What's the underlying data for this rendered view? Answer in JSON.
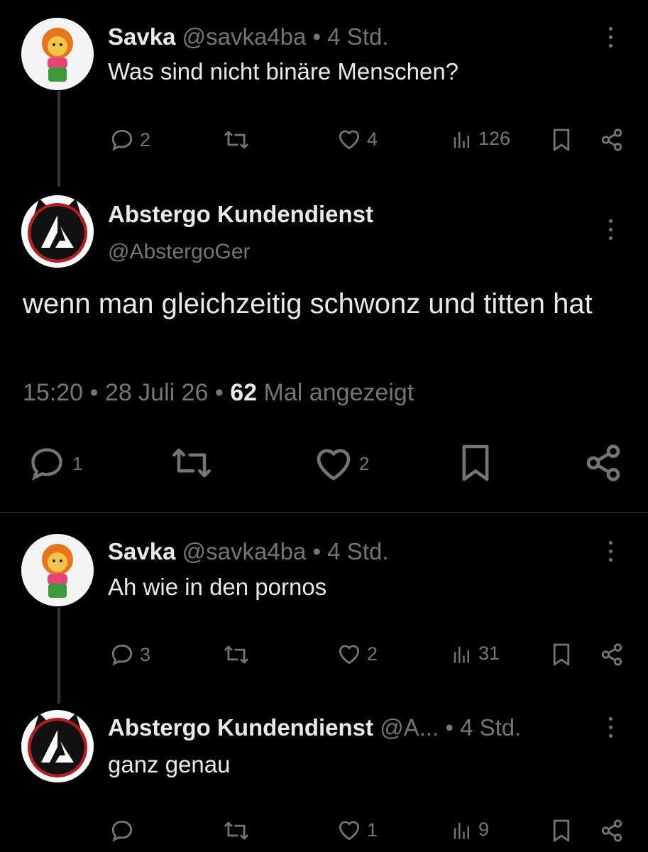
{
  "tweets": [
    {
      "name": "Savka",
      "handle": "@savka4ba",
      "time": "4 Std.",
      "text": "Was sind nicht binäre Menschen?",
      "replies": "2",
      "likes": "4",
      "views": "126"
    },
    {
      "name": "Abstergo Kundendienst",
      "handle": "@AbstergoGer",
      "text": "wenn man gleichzeitig schwonz und titten hat",
      "meta_time": "15:20",
      "meta_date": "28 Juli 26",
      "meta_views_count": "62",
      "meta_views_label": "Mal angezeigt",
      "replies": "1",
      "likes": "2"
    },
    {
      "name": "Savka",
      "handle": "@savka4ba",
      "time": "4 Std.",
      "text": "Ah wie in den pornos",
      "replies": "3",
      "likes": "2",
      "views": "31"
    },
    {
      "name": "Abstergo Kundendienst",
      "handle": "@A...",
      "time": "4 Std.",
      "text": "ganz genau",
      "likes": "1",
      "views": "9"
    }
  ],
  "separator": "•",
  "icons": {
    "reply": "reply-icon",
    "retweet": "retweet-icon",
    "like": "heart-icon",
    "views": "views-icon",
    "bookmark": "bookmark-icon",
    "share": "share-icon",
    "more": "more-icon"
  }
}
